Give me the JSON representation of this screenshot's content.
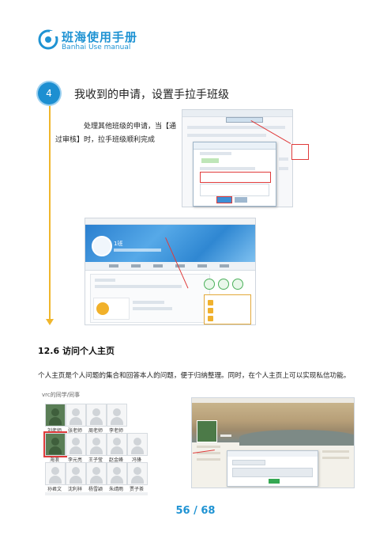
{
  "header": {
    "title": "班海使用手册",
    "subtitle": "Banhai Use manual",
    "brand_color": "#1f93d3"
  },
  "step": {
    "number": "4",
    "title": "我收到的申请，设置手拉手班级",
    "desc_line1": "处理其他班级的申请，当【通",
    "desc_line2": "过审核】时，拉手班级顺利完成",
    "line_color": "#f0b62c"
  },
  "screenshot_b": {
    "class_name": "1班"
  },
  "section": {
    "title": "12.6 访问个人主页",
    "desc": "个人主页是个人问题的集合和回答本人的问题，便于归纳整理。同时，在个人主页上可以实现私信功能。"
  },
  "people_grid": {
    "title": "vrc的同学/同事",
    "rows": [
      [
        "刘老师",
        "张老师",
        "周老师",
        "李老师"
      ],
      [
        "海浪",
        "李元亮",
        "王子莹",
        "赵金峰",
        "冯锋"
      ],
      [
        "孙君文",
        "沈利祥",
        "杨雪颖",
        "朱靖雨",
        "贾子茶"
      ]
    ]
  },
  "page_number": "56 / 68"
}
